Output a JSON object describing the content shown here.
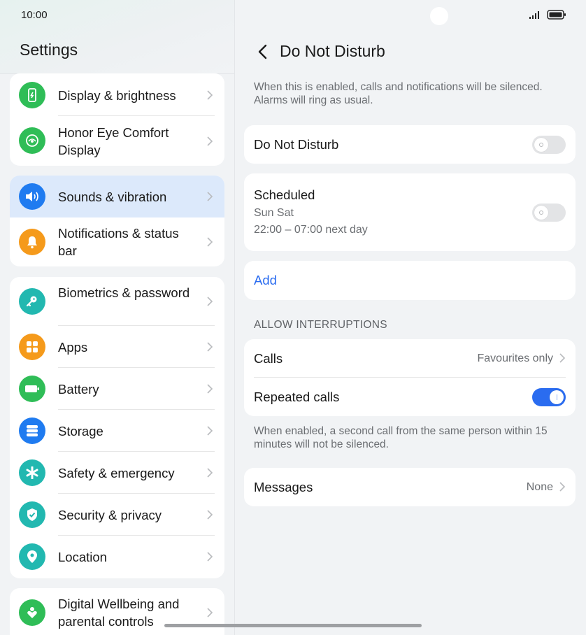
{
  "status": {
    "time": "10:00"
  },
  "left": {
    "title": "Settings",
    "items": [
      {
        "label": "Display & brightness",
        "icon": "display-brightness-icon",
        "color": "#2fbd57"
      },
      {
        "label": "Honor Eye Comfort Display",
        "icon": "eye-comfort-icon",
        "color": "#2fbd57"
      },
      {
        "label": "Sounds & vibration",
        "icon": "speaker-icon",
        "color": "#1f7bf0",
        "selected": true
      },
      {
        "label": "Notifications & status bar",
        "icon": "bell-icon",
        "color": "#f59a1b"
      },
      {
        "label": "Biometrics & password",
        "icon": "key-icon",
        "color": "#22b8b0"
      },
      {
        "label": "Apps",
        "icon": "apps-grid-icon",
        "color": "#f59a1b"
      },
      {
        "label": "Battery",
        "icon": "battery-icon",
        "color": "#2fbd57"
      },
      {
        "label": "Storage",
        "icon": "storage-icon",
        "color": "#1f7bf0"
      },
      {
        "label": "Safety & emergency",
        "icon": "asterisk-icon",
        "color": "#22b8b0"
      },
      {
        "label": "Security & privacy",
        "icon": "shield-icon",
        "color": "#22b8b0"
      },
      {
        "label": "Location",
        "icon": "location-pin-icon",
        "color": "#22b8b0"
      },
      {
        "label": "Digital Wellbeing and parental controls",
        "icon": "wellbeing-icon",
        "color": "#2fbd57"
      }
    ]
  },
  "right": {
    "title": "Do Not Disturb",
    "description": "When this is enabled, calls and notifications will be silenced. Alarms will ring as usual.",
    "dnd": {
      "label": "Do Not Disturb",
      "enabled": false
    },
    "scheduled": {
      "label": "Scheduled",
      "days": "Sun Sat",
      "time": "22:00 – 07:00 next day",
      "enabled": false
    },
    "add_label": "Add",
    "section_header": "ALLOW INTERRUPTIONS",
    "calls": {
      "label": "Calls",
      "value": "Favourites only"
    },
    "repeated_calls": {
      "label": "Repeated calls",
      "enabled": true
    },
    "repeated_desc": "When enabled, a second call from the same person within 15 minutes will not be silenced.",
    "messages": {
      "label": "Messages",
      "value": "None"
    }
  },
  "colors": {
    "accent": "#2a6cf0",
    "selected_bg": "#dce9fb"
  }
}
